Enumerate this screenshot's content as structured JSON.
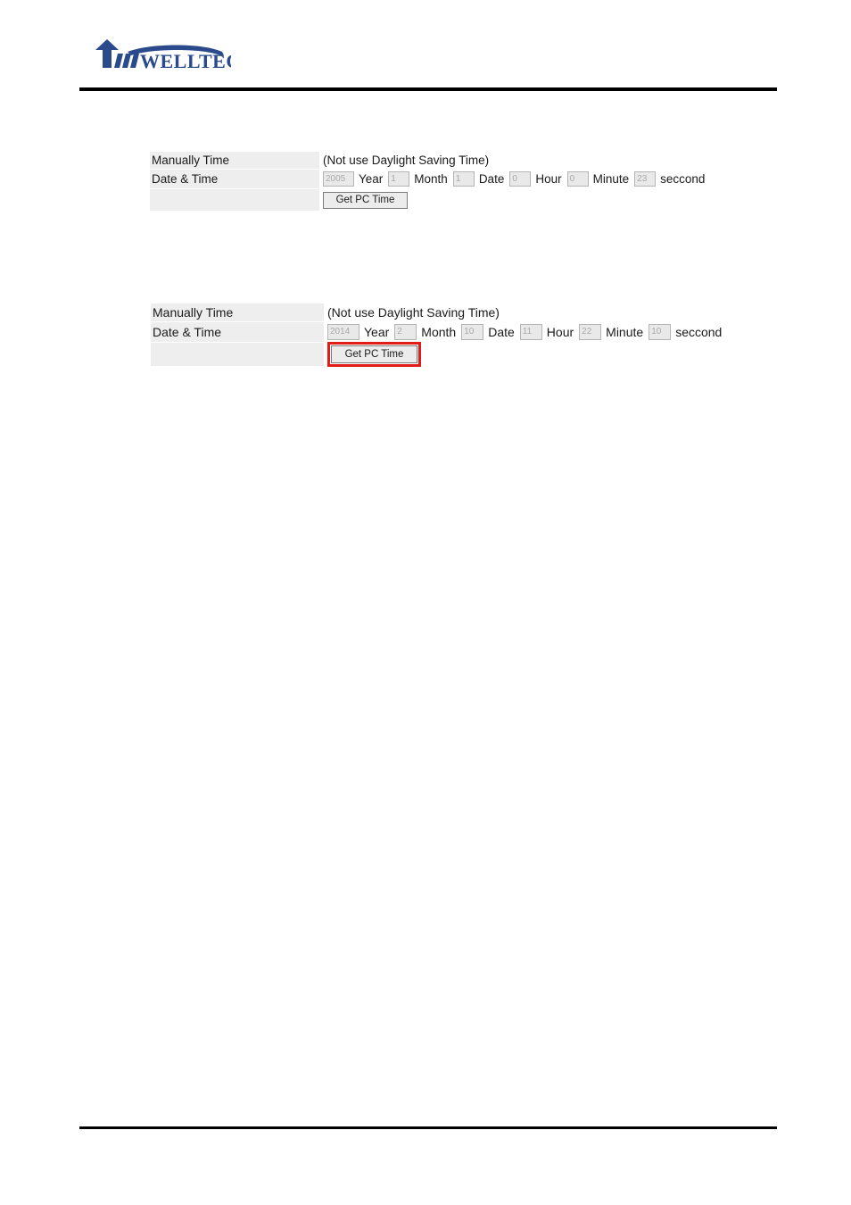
{
  "header": {
    "brand_name": "WELLTECH",
    "brand_color": "#2b4a8b",
    "logo_icon": "welltech-logo"
  },
  "screenshots": [
    {
      "id": "shot-1",
      "highlighted": false,
      "rows": {
        "manual_label": "Manually Time",
        "dst_note": "(Not use Daylight Saving Time)",
        "datetime_label": "Date & Time",
        "action_label": ""
      },
      "fields": [
        {
          "name": "year",
          "value": "2005",
          "unit": "Year"
        },
        {
          "name": "month",
          "value": "1",
          "unit": "Month"
        },
        {
          "name": "date",
          "value": "1",
          "unit": "Date"
        },
        {
          "name": "hour",
          "value": "0",
          "unit": "Hour"
        },
        {
          "name": "minute",
          "value": "0",
          "unit": "Minute"
        },
        {
          "name": "seccond",
          "value": "23",
          "unit": "seccond"
        }
      ],
      "button_label": "Get PC Time"
    },
    {
      "id": "shot-2",
      "highlighted": true,
      "highlight_color": "#e31b18",
      "rows": {
        "manual_label": "Manually Time",
        "dst_note": "(Not use Daylight Saving Time)",
        "datetime_label": "Date & Time",
        "action_label": ""
      },
      "fields": [
        {
          "name": "year",
          "value": "2014",
          "unit": "Year"
        },
        {
          "name": "month",
          "value": "2",
          "unit": "Month"
        },
        {
          "name": "date",
          "value": "10",
          "unit": "Date"
        },
        {
          "name": "hour",
          "value": "11",
          "unit": "Hour"
        },
        {
          "name": "minute",
          "value": "22",
          "unit": "Minute"
        },
        {
          "name": "seccond",
          "value": "10",
          "unit": "seccond"
        }
      ],
      "button_label": "Get PC Time"
    }
  ]
}
